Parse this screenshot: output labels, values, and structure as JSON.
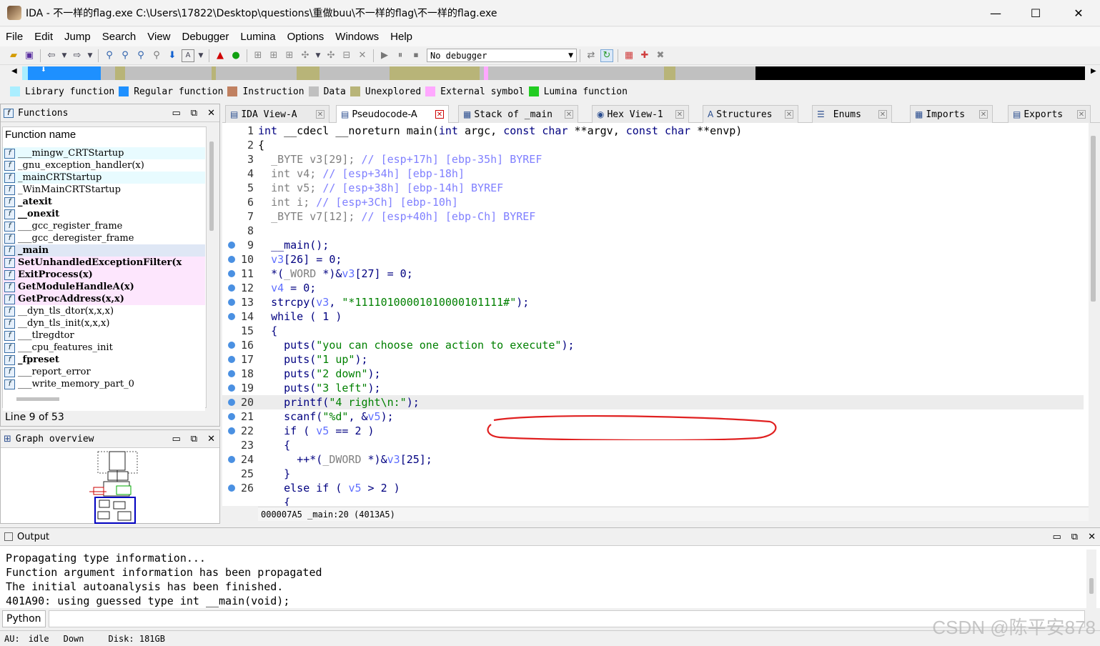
{
  "window": {
    "title": "IDA - 不一样的flag.exe C:\\Users\\17822\\Desktop\\questions\\重做buu\\不一样的flag\\不一样的flag.exe",
    "minimize": "—",
    "maximize": "☐",
    "close": "✕"
  },
  "menu": [
    "File",
    "Edit",
    "Jump",
    "Search",
    "View",
    "Debugger",
    "Lumina",
    "Options",
    "Windows",
    "Help"
  ],
  "toolbar": {
    "debugger_select": "No debugger"
  },
  "legend": [
    {
      "label": "Library function",
      "color": "#aaeeff"
    },
    {
      "label": "Regular function",
      "color": "#1e90ff"
    },
    {
      "label": "Instruction",
      "color": "#c08060"
    },
    {
      "label": "Data",
      "color": "#c0c0c0"
    },
    {
      "label": "Unexplored",
      "color": "#b8b478"
    },
    {
      "label": "External symbol",
      "color": "#ffa8ff"
    },
    {
      "label": "Lumina function",
      "color": "#22cc22"
    }
  ],
  "functions_panel": {
    "title": "Functions",
    "column": "Function name",
    "items": [
      {
        "name": "___mingw_CRTStartup",
        "kind": "lib"
      },
      {
        "name": "_gnu_exception_handler(x)",
        "kind": "normal"
      },
      {
        "name": "_mainCRTStartup",
        "kind": "lib"
      },
      {
        "name": "_WinMainCRTStartup",
        "kind": "normal"
      },
      {
        "name": "_atexit",
        "kind": "bold"
      },
      {
        "name": "__onexit",
        "kind": "bold"
      },
      {
        "name": "___gcc_register_frame",
        "kind": "normal"
      },
      {
        "name": "___gcc_deregister_frame",
        "kind": "normal"
      },
      {
        "name": "_main",
        "kind": "boldsel"
      },
      {
        "name": "SetUnhandledExceptionFilter(x",
        "kind": "ext"
      },
      {
        "name": "ExitProcess(x)",
        "kind": "ext"
      },
      {
        "name": "GetModuleHandleA(x)",
        "kind": "ext"
      },
      {
        "name": "GetProcAddress(x,x)",
        "kind": "ext"
      },
      {
        "name": "__dyn_tls_dtor(x,x,x)",
        "kind": "normal"
      },
      {
        "name": "__dyn_tls_init(x,x,x)",
        "kind": "normal"
      },
      {
        "name": "___tlregdtor",
        "kind": "normal"
      },
      {
        "name": "___cpu_features_init",
        "kind": "normal"
      },
      {
        "name": "_fpreset",
        "kind": "bold"
      },
      {
        "name": "___report_error",
        "kind": "normal"
      },
      {
        "name": "___write_memory_part_0",
        "kind": "normal"
      }
    ],
    "status": "Line 9 of 53"
  },
  "graph_panel": {
    "title": "Graph overview"
  },
  "tabs": [
    {
      "label": "IDA View-A",
      "icon": "▤"
    },
    {
      "label": "Pseudocode-A",
      "icon": "▤"
    },
    {
      "label": "Stack of _main",
      "icon": "▦"
    },
    {
      "label": "Hex View-1",
      "icon": "◉"
    },
    {
      "label": "Structures",
      "icon": "A"
    },
    {
      "label": "Enums",
      "icon": "☰"
    },
    {
      "label": "Imports",
      "icon": "▦"
    },
    {
      "label": "Exports",
      "icon": "▤"
    }
  ],
  "code_lines": [
    {
      "n": "1",
      "dot": false,
      "html": "<span class='k'>int</span> __cdecl __noreturn main(<span class='k'>int</span> argc, <span class='k'>const char</span> **argv, <span class='k'>const char</span> **envp)"
    },
    {
      "n": "2",
      "dot": false,
      "html": "{"
    },
    {
      "n": "3",
      "dot": false,
      "html": "  <span class='g'>_BYTE v3[29];</span> <span class='c'>// [esp+17h] [ebp-35h] BYREF</span>"
    },
    {
      "n": "4",
      "dot": false,
      "html": "  <span class='g'>int v4;</span> <span class='c'>// [esp+34h] [ebp-18h]</span>"
    },
    {
      "n": "5",
      "dot": false,
      "html": "  <span class='g'>int v5;</span> <span class='c'>// [esp+38h] [ebp-14h] BYREF</span>"
    },
    {
      "n": "6",
      "dot": false,
      "html": "  <span class='g'>int i;</span> <span class='c'>// [esp+3Ch] [ebp-10h]</span>"
    },
    {
      "n": "7",
      "dot": false,
      "html": "  <span class='g'>_BYTE v7[12];</span> <span class='c'>// [esp+40h] [ebp-Ch] BYREF</span>"
    },
    {
      "n": "8",
      "dot": false,
      "html": ""
    },
    {
      "n": "9",
      "dot": true,
      "html": "  <span class='k'>__main();</span>"
    },
    {
      "n": "10",
      "dot": true,
      "html": "  <span class='v'>v3</span><span class='k'>[26] = 0;</span>"
    },
    {
      "n": "11",
      "dot": true,
      "html": "  <span class='k'>*(</span><span class='g'>_WORD</span> <span class='k'>*)&amp;</span><span class='v'>v3</span><span class='k'>[27] = 0;</span>"
    },
    {
      "n": "12",
      "dot": true,
      "html": "  <span class='v'>v4</span><span class='k'> = 0;</span>"
    },
    {
      "n": "13",
      "dot": true,
      "html": "  <span class='k'>strcpy(</span><span class='v'>v3</span><span class='k'>, </span><span class='s'>\"*11110100001010000101111#\"</span><span class='k'>);</span>"
    },
    {
      "n": "14",
      "dot": true,
      "html": "  <span class='k'>while ( 1 )</span>"
    },
    {
      "n": "15",
      "dot": false,
      "html": "  <span class='k'>{</span>"
    },
    {
      "n": "16",
      "dot": true,
      "html": "    <span class='k'>puts(</span><span class='s'>\"you can choose one action to execute\"</span><span class='k'>);</span>"
    },
    {
      "n": "17",
      "dot": true,
      "html": "    <span class='k'>puts(</span><span class='s'>\"1 up\"</span><span class='k'>);</span>"
    },
    {
      "n": "18",
      "dot": true,
      "html": "    <span class='k'>puts(</span><span class='s'>\"2 down\"</span><span class='k'>);</span>"
    },
    {
      "n": "19",
      "dot": true,
      "html": "    <span class='k'>puts(</span><span class='s'>\"3 left\"</span><span class='k'>);</span>"
    },
    {
      "n": "20",
      "dot": true,
      "html": "    <span class='k'>printf(</span><span class='s'>\"4 right\\n:\"</span><span class='k'>);</span>"
    },
    {
      "n": "21",
      "dot": true,
      "html": "    <span class='k'>scanf(</span><span class='s'>\"%d\"</span><span class='k'>, &amp;</span><span class='v'>v5</span><span class='k'>);</span>"
    },
    {
      "n": "22",
      "dot": true,
      "html": "    <span class='k'>if ( </span><span class='v'>v5</span><span class='k'> == 2 )</span>"
    },
    {
      "n": "23",
      "dot": false,
      "html": "    <span class='k'>{</span>"
    },
    {
      "n": "24",
      "dot": true,
      "html": "      <span class='k'>++*(</span><span class='g'>_DWORD</span> <span class='k'>*)&amp;</span><span class='v'>v3</span><span class='k'>[25];</span>"
    },
    {
      "n": "25",
      "dot": false,
      "html": "    <span class='k'>}</span>"
    },
    {
      "n": "26",
      "dot": true,
      "html": "    <span class='k'>else if ( </span><span class='v'>v5</span><span class='k'> &gt; 2 )</span>"
    },
    {
      "n": "",
      "dot": false,
      "html": "    <span class='k'>{</span>"
    }
  ],
  "code_status": "000007A5 _main:20 (4013A5)",
  "output_panel": {
    "title": "Output",
    "lines": [
      "Propagating type information...",
      "Function argument information has been propagated",
      "The initial autoanalysis has been finished.",
      "401A90: using guessed type int __main(void);"
    ]
  },
  "python_button": "Python",
  "status_bar": {
    "au_label": "AU:",
    "au_state": "idle",
    "direction": "Down",
    "disk": "Disk: 181GB"
  },
  "watermark": "CSDN @陈平安878"
}
